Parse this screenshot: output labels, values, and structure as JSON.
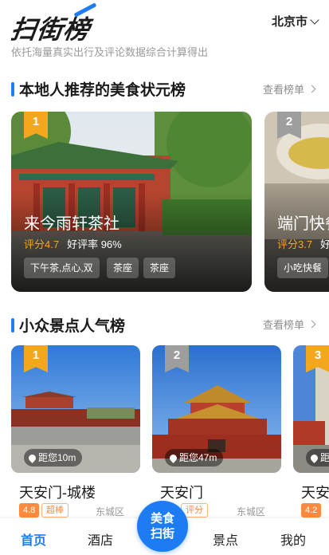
{
  "app": {
    "logo_text": "扫街榜",
    "subtitle": "依托海量真实出行及评论数据综合计算得出",
    "city": "北京市"
  },
  "food_section": {
    "title": "本地人推荐的美食状元榜",
    "more_label": "查看榜单",
    "cards": [
      {
        "rank": "1",
        "name": "来今雨轩茶社",
        "score": "评分4.7",
        "rate": "好评率 96%",
        "tags": [
          "下午茶,点心,双",
          "茶座",
          "茶座"
        ]
      },
      {
        "rank": "2",
        "name": "端门快餐",
        "score": "评分3.7",
        "rate": "好",
        "tags": [
          "小吃快餐"
        ]
      }
    ]
  },
  "spot_section": {
    "title": "小众景点人气榜",
    "more_label": "查看榜单",
    "cards": [
      {
        "rank": "1",
        "distance": "距您10m",
        "name": "天安门-城楼",
        "score": "4.8",
        "tag": "超棒",
        "district": "东城区"
      },
      {
        "rank": "2",
        "distance": "距您47m",
        "name": "天安门",
        "score": "",
        "tag": "评分",
        "district": "东城区"
      },
      {
        "rank": "3",
        "distance": "距",
        "name": "天安",
        "score": "4.2",
        "tag": "",
        "district": ""
      }
    ]
  },
  "tabbar": {
    "home": "首页",
    "hotel": "酒店",
    "center_line1": "美食",
    "center_line2": "扫街",
    "spots": "景点",
    "mine": "我的"
  },
  "colors": {
    "accent": "#1e7cf2",
    "rank_gold": "#f2a71c",
    "rank_grey": "#9e9e9e",
    "score_orange": "#f5a623"
  }
}
